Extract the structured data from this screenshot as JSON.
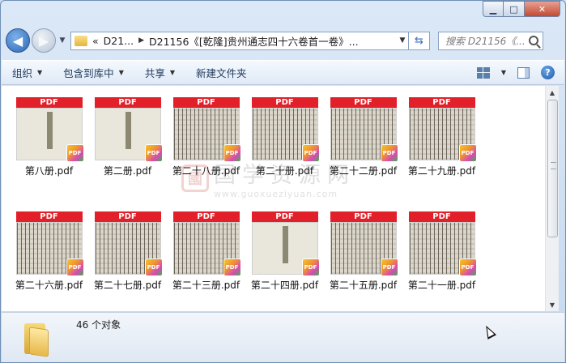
{
  "window": {
    "min_label": "▁",
    "max_label": "□",
    "close_label": "✕"
  },
  "nav": {
    "back_glyph": "◀",
    "forward_glyph": "▶",
    "history_glyph": "▼",
    "breadcrumb_overflow": "«",
    "breadcrumb_parent": "D21...",
    "breadcrumb_current": "D21156《[乾隆]贵州通志四十六卷首一卷》...",
    "search_placeholder": "搜索 D21156《..."
  },
  "toolbar": {
    "organize": "组织",
    "include_in_library": "包含到库中",
    "share": "共享",
    "new_folder": "新建文件夹",
    "help": "?"
  },
  "files": [
    {
      "name": "第八册.pdf",
      "page": "blank"
    },
    {
      "name": "第二册.pdf",
      "page": "blank"
    },
    {
      "name": "第二十八册.pdf",
      "page": "text"
    },
    {
      "name": "第二十册.pdf",
      "page": "text"
    },
    {
      "name": "第二十二册.pdf",
      "page": "text"
    },
    {
      "name": "第二十九册.pdf",
      "page": "text"
    },
    {
      "name": "第二十六册.pdf",
      "page": "text"
    },
    {
      "name": "第二十七册.pdf",
      "page": "text"
    },
    {
      "name": "第二十三册.pdf",
      "page": "text"
    },
    {
      "name": "第二十四册.pdf",
      "page": "blank"
    },
    {
      "name": "第二十五册.pdf",
      "page": "text"
    },
    {
      "name": "第二十一册.pdf",
      "page": "text"
    }
  ],
  "pdf_banner": "PDF",
  "pdf_badge": "PDF",
  "watermark": {
    "seal": "國",
    "cn": "国学资源网",
    "en": "www.guoxueziyuan.com"
  },
  "status": {
    "count": "46 个对象"
  },
  "colors": {
    "pdf_red": "#e2202a",
    "window_frame": "#c6d9ef"
  }
}
